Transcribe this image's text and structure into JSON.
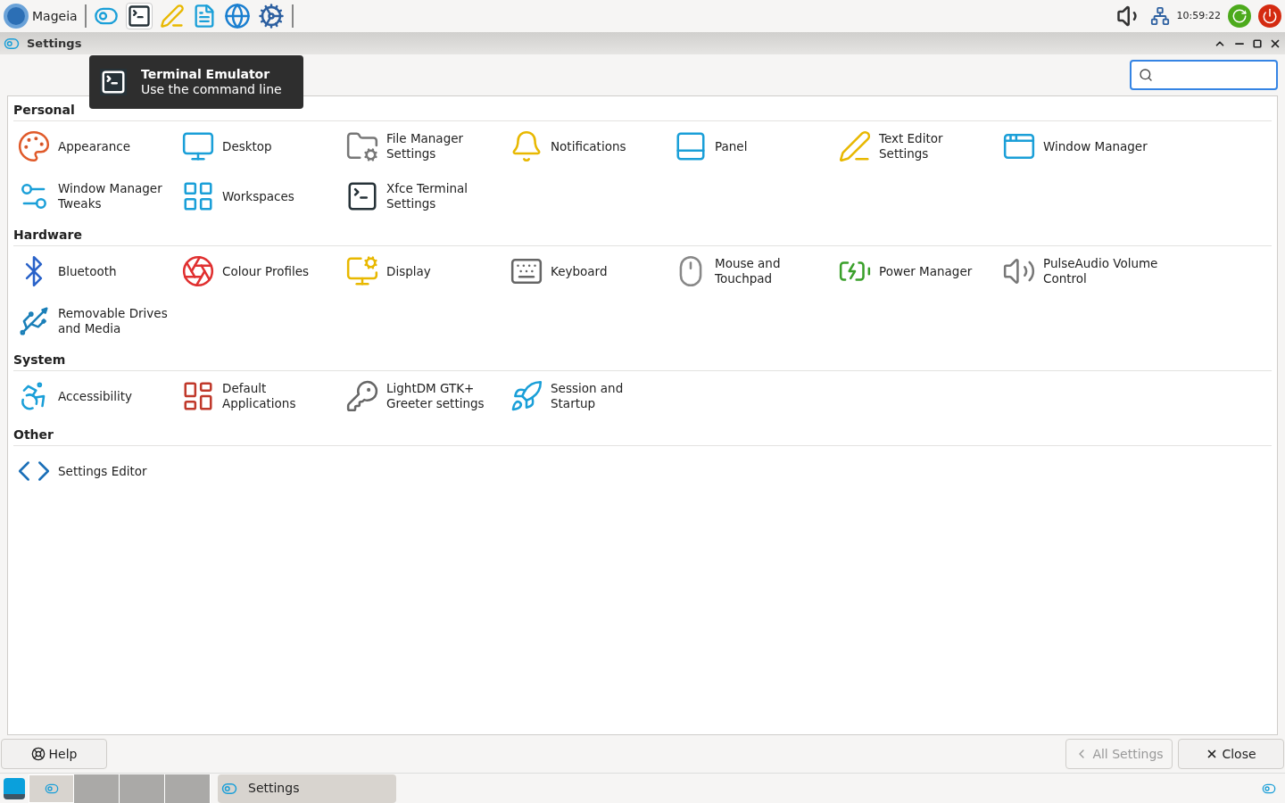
{
  "top_panel": {
    "menu_label": "Mageia",
    "clock": "10:59:22"
  },
  "tooltip": {
    "title": "Terminal Emulator",
    "subtitle": "Use the command line"
  },
  "window": {
    "title": "Settings"
  },
  "sections": [
    {
      "title": "Personal",
      "items": [
        {
          "label": "Appearance"
        },
        {
          "label": "Desktop"
        },
        {
          "label": "File Manager Settings"
        },
        {
          "label": "Notifications"
        },
        {
          "label": "Panel"
        },
        {
          "label": "Text Editor Settings"
        },
        {
          "label": "Window Manager"
        },
        {
          "label": "Window Manager Tweaks"
        },
        {
          "label": "Workspaces"
        },
        {
          "label": "Xfce Terminal Settings"
        }
      ]
    },
    {
      "title": "Hardware",
      "items": [
        {
          "label": "Bluetooth"
        },
        {
          "label": "Colour Profiles"
        },
        {
          "label": "Display"
        },
        {
          "label": "Keyboard"
        },
        {
          "label": "Mouse and Touchpad"
        },
        {
          "label": "Power Manager"
        },
        {
          "label": "PulseAudio Volume Control"
        },
        {
          "label": "Removable Drives and Media"
        }
      ]
    },
    {
      "title": "System",
      "items": [
        {
          "label": "Accessibility"
        },
        {
          "label": "Default Applications"
        },
        {
          "label": "LightDM GTK+ Greeter settings"
        },
        {
          "label": "Session and Startup"
        }
      ]
    },
    {
      "title": "Other",
      "items": [
        {
          "label": "Settings Editor"
        }
      ]
    }
  ],
  "buttons": {
    "help": "Help",
    "all_settings": {
      "label": "All Settings",
      "disabled": true
    },
    "close": "Close"
  },
  "taskbar": {
    "workspaces": [
      {
        "selected": true
      },
      {
        "selected": false
      },
      {
        "selected": false
      },
      {
        "selected": false
      }
    ],
    "window_button": "Settings"
  }
}
